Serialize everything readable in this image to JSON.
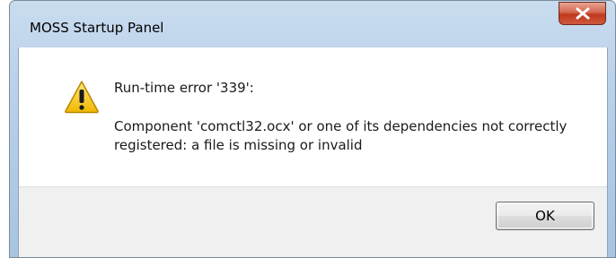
{
  "window": {
    "title": "MOSS Startup Panel",
    "close_icon": "close-x-icon"
  },
  "message": {
    "icon": "warning-triangle-icon",
    "title": "Run-time error '339':",
    "body": "Component 'comctl32.ocx' or one of its dependencies not correctly registered: a file is missing or invalid"
  },
  "buttons": {
    "ok_label": "OK"
  },
  "colors": {
    "titlebar": "#b8cfe8",
    "close_button": "#c7462a",
    "warning_fill": "#f5c400",
    "dialog_footer": "#f0f0f0"
  }
}
